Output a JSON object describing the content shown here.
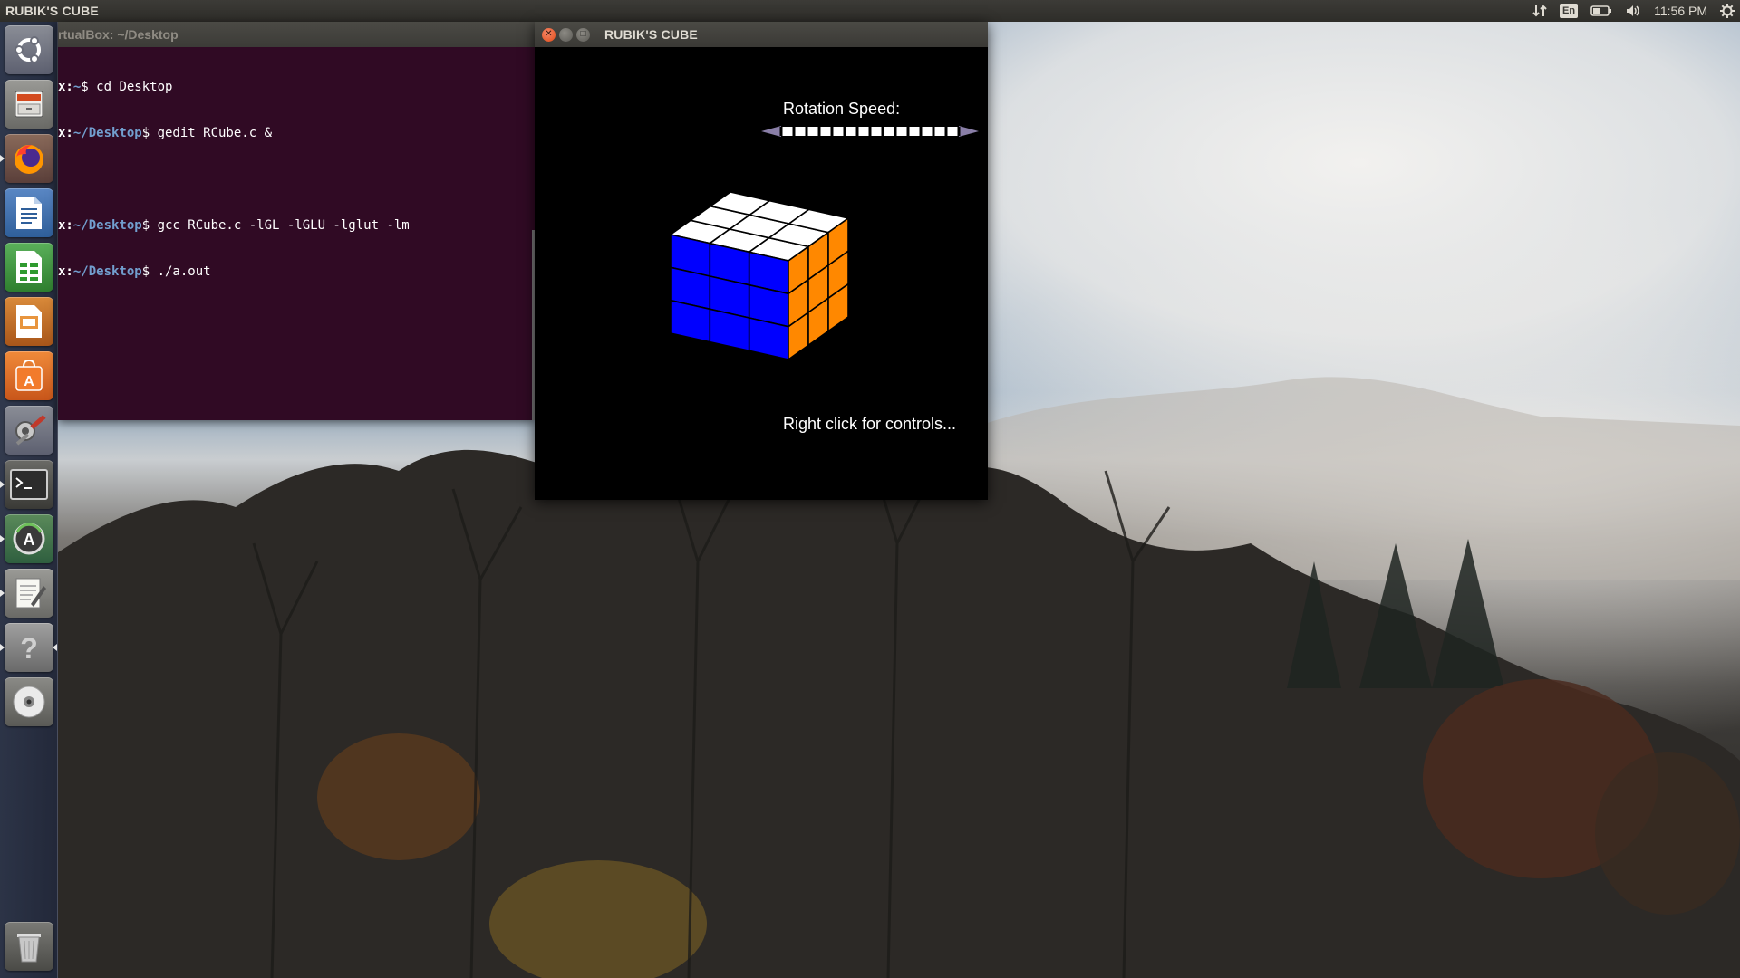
{
  "panel": {
    "title": "RUBIK'S CUBE",
    "keyboard_layout": "En",
    "clock": "11:56 PM"
  },
  "launcher": {
    "items": [
      {
        "name": "dash-home",
        "icon": "ubuntu-logo-icon"
      },
      {
        "name": "files",
        "icon": "file-cabinet-icon"
      },
      {
        "name": "firefox",
        "icon": "firefox-icon"
      },
      {
        "name": "libreoffice-writer",
        "icon": "writer-document-icon"
      },
      {
        "name": "libreoffice-calc",
        "icon": "calc-spreadsheet-icon"
      },
      {
        "name": "libreoffice-impress",
        "icon": "impress-presentation-icon"
      },
      {
        "name": "ubuntu-software",
        "icon": "software-bag-icon"
      },
      {
        "name": "system-settings",
        "icon": "settings-tools-icon"
      },
      {
        "name": "terminal",
        "icon": "terminal-icon"
      },
      {
        "name": "software-updater",
        "icon": "updater-icon"
      },
      {
        "name": "text-editor",
        "icon": "text-editor-icon"
      },
      {
        "name": "unknown-app",
        "icon": "question-mark-icon"
      },
      {
        "name": "optical-disc",
        "icon": "disc-icon"
      },
      {
        "name": "trash",
        "icon": "trash-icon"
      }
    ]
  },
  "terminal": {
    "title": "rtualBox: ~/Desktop",
    "lines": [
      {
        "prompt": "x:",
        "path": "~",
        "cmd": "$ cd Desktop"
      },
      {
        "prompt": "x:",
        "path": "~/Desktop",
        "cmd": "$ gedit RCube.c &"
      },
      {
        "prompt": "",
        "path": "",
        "cmd": ""
      },
      {
        "prompt": "x:",
        "path": "~/Desktop",
        "cmd": "$ gcc RCube.c -lGL -lGLU -lglut -lm"
      },
      {
        "prompt": "x:",
        "path": "~/Desktop",
        "cmd": "$ ./a.out"
      }
    ]
  },
  "rubik": {
    "window_title": "RUBIK'S CUBE",
    "speed_label": "Rotation Speed:",
    "slider_segments": 14,
    "controls_hint": "Right click for controls...",
    "face_colors": {
      "top": "#ffffff",
      "front": "#0000ff",
      "right": "#ff8800"
    }
  },
  "colors": {
    "terminal_bg": "#300a24",
    "terminal_path": "#729fcf",
    "panel_bg": "#3c3b37",
    "close_button": "#df4a16"
  }
}
